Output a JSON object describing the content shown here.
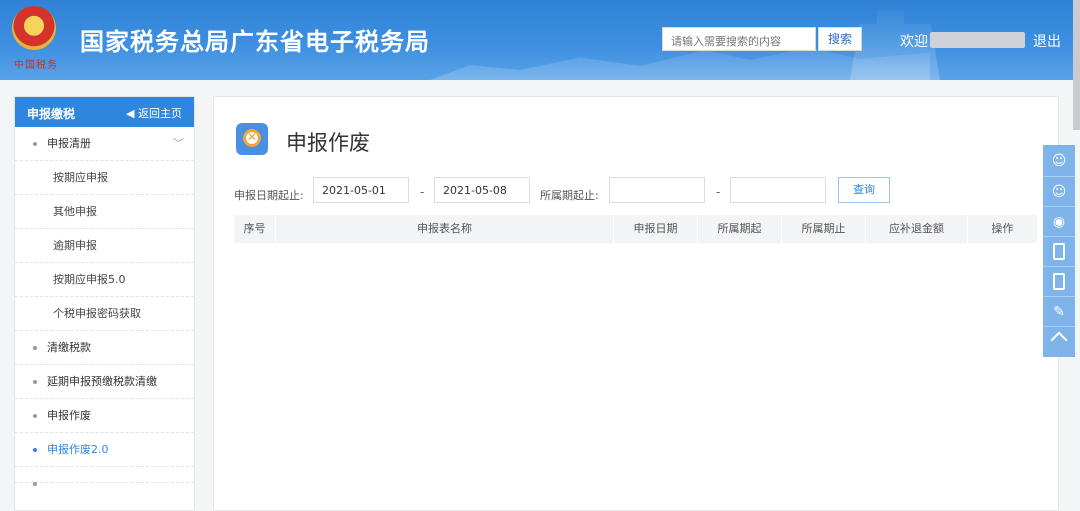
{
  "header": {
    "emblem_text": "中国税务",
    "site_title": "国家税务总局广东省电子税务局",
    "search_placeholder": "请输入需要搜索的内容",
    "search_button": "搜索",
    "welcome": "欢迎",
    "logout": "退出"
  },
  "sidebar": {
    "title": "申报缴税",
    "back_label": "返回主页",
    "items": [
      {
        "label": "申报清册",
        "level": 1,
        "expanded": true
      },
      {
        "label": "按期应申报",
        "level": 2
      },
      {
        "label": "其他申报",
        "level": 2
      },
      {
        "label": "逾期申报",
        "level": 2
      },
      {
        "label": "按期应申报5.0",
        "level": 2
      },
      {
        "label": "个税申报密码获取",
        "level": 2
      },
      {
        "label": "清缴税款",
        "level": 1
      },
      {
        "label": "延期申报预缴税款清缴",
        "level": 1
      },
      {
        "label": "申报作废",
        "level": 1
      },
      {
        "label": "申报作废2.0",
        "level": 1,
        "active": true
      }
    ]
  },
  "main": {
    "title": "申报作废",
    "filters": {
      "date_label": "申报日期起止:",
      "date_start": "2021-05-01",
      "date_end": "2021-05-08",
      "period_label": "所属期起止:",
      "period_start": "",
      "period_end": "",
      "separator": "-",
      "query_button": "查询"
    },
    "table": {
      "columns": [
        "序号",
        "申报表名称",
        "申报日期",
        "所属期起",
        "所属期止",
        "应补退金额",
        "操作"
      ],
      "rows": []
    }
  },
  "float_toolbar": {
    "items": [
      "wechat-icon",
      "wechat-icon",
      "weibo-icon",
      "mobile-icon",
      "mobile-icon",
      "feedback-icon",
      "back-to-top-icon"
    ]
  },
  "colors": {
    "header_blue": "#3d8fe0",
    "sidebar_head": "#2f86df",
    "active_link": "#2f86df",
    "float_bar": "#7fb4ea"
  }
}
